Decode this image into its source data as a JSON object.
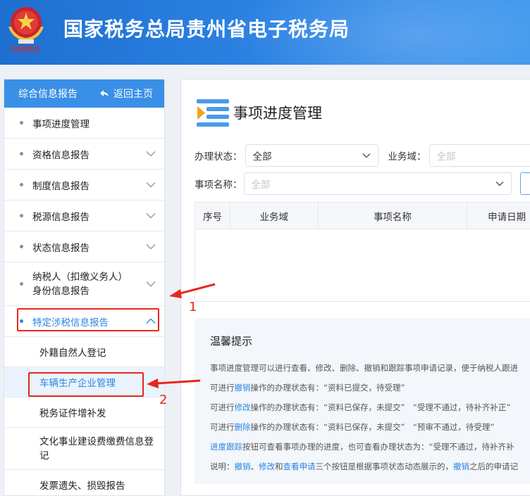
{
  "header": {
    "title": "国家税务总局贵州省电子税务局",
    "emblem_text": "中国税务"
  },
  "sidebar": {
    "section_title": "综合信息报告",
    "home_label": "返回主页",
    "items": [
      {
        "label": "事项进度管理"
      },
      {
        "label": "资格信息报告"
      },
      {
        "label": "制度信息报告"
      },
      {
        "label": "税源信息报告"
      },
      {
        "label": "状态信息报告"
      },
      {
        "label": "纳税人（扣缴义务人）身份信息报告"
      },
      {
        "label": "特定涉税信息报告"
      }
    ],
    "sub_items": [
      {
        "label": "外籍自然人登记"
      },
      {
        "label": "车辆生产企业管理"
      },
      {
        "label": "税务证件增补发"
      },
      {
        "label": "文化事业建设费缴费信息登记"
      },
      {
        "label": "发票遗失、损毁报告"
      }
    ]
  },
  "main": {
    "title": "事项进度管理",
    "status_label": "办理状态：",
    "status_value": "全部",
    "domain_label": "业务域：",
    "domain_placeholder": "全部",
    "name_label": "事项名称：",
    "name_placeholder": "全部",
    "table_headers": [
      "序号",
      "业务域",
      "事项名称",
      "申请日期"
    ],
    "tips": {
      "title": "温馨提示",
      "line1": "事项进度管理可以进行查看、修改、删除、撤销和跟踪事项申请记录，便于纳税人跟进",
      "line2_a": "可进行",
      "line2_hl": "撤销",
      "line2_b": "操作的办理状态有：“资料已提交，待受理”",
      "line3_a": "可进行",
      "line3_hl": "修改",
      "line3_b": "操作的办理状态有：“资料已保存，未提交”　“受理不通过，待补齐补正”",
      "line4_a": "可进行",
      "line4_hl": "删除",
      "line4_b": "操作的办理状态有：“资料已保存，未提交”　“预审不通过，待受理”",
      "line5_hl": "进度跟踪",
      "line5_b": "按钮可查看事项办理的进度，也可查看办理状态为：“受理不通过，待补齐补",
      "line6_a": "说明：",
      "line6_hl1": "撤销",
      "line6_sep1": "、",
      "line6_hl2": "修改",
      "line6_sep2": "和",
      "line6_hl3": "查看申请",
      "line6_b": "三个按钮是根据事项状态动态展示的，",
      "line6_hl4": "撤销",
      "line6_c": "之后的申请记"
    }
  },
  "annotations": {
    "one": "1",
    "two": "2"
  },
  "colors": {
    "accent": "#2b86e0",
    "header": "#1e6fd0",
    "annotation": "#e8271c"
  }
}
